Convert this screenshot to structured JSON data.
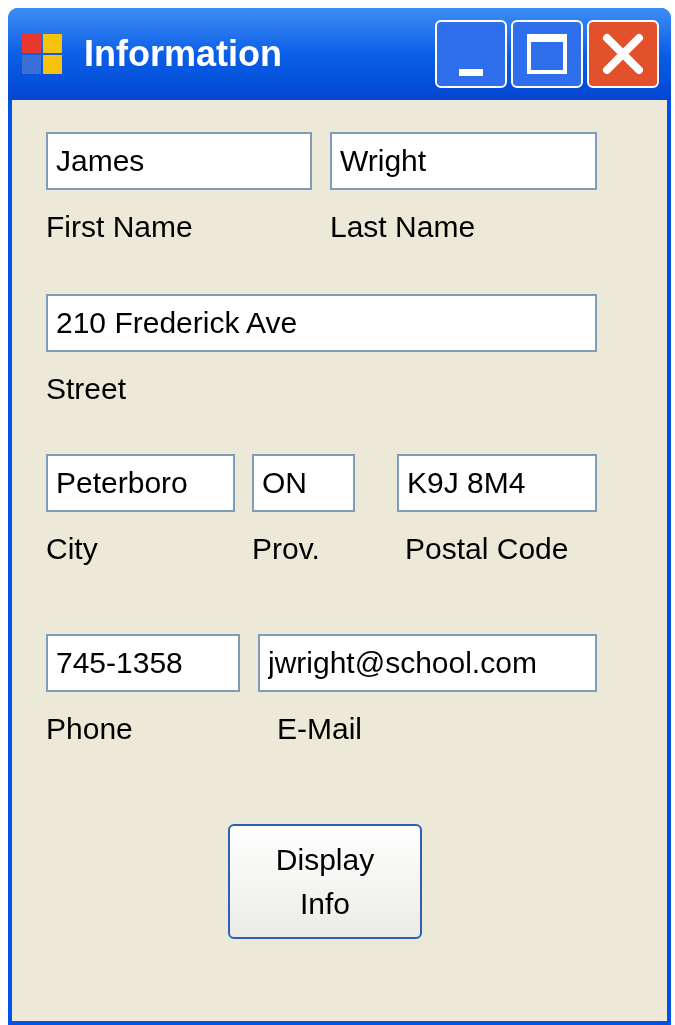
{
  "window": {
    "title": "Information"
  },
  "rows": [
    {
      "fields": [
        {
          "value": "James",
          "label": "First Name"
        },
        {
          "value": "Wright",
          "label": "Last Name"
        }
      ]
    },
    {
      "fields": [
        {
          "value": "210 Frederick Ave",
          "label": "Street"
        }
      ]
    },
    {
      "fields": [
        {
          "value": "Peterboro",
          "label": "City"
        },
        {
          "value": "ON",
          "label": "Prov."
        },
        {
          "value": "K9J 8M4",
          "label": "Postal Code"
        }
      ]
    },
    {
      "fields": [
        {
          "value": "745-1358",
          "label": "Phone"
        },
        {
          "value": "jwright@school.com",
          "label": "E-Mail"
        }
      ]
    }
  ],
  "button": {
    "label": "Display Info"
  }
}
